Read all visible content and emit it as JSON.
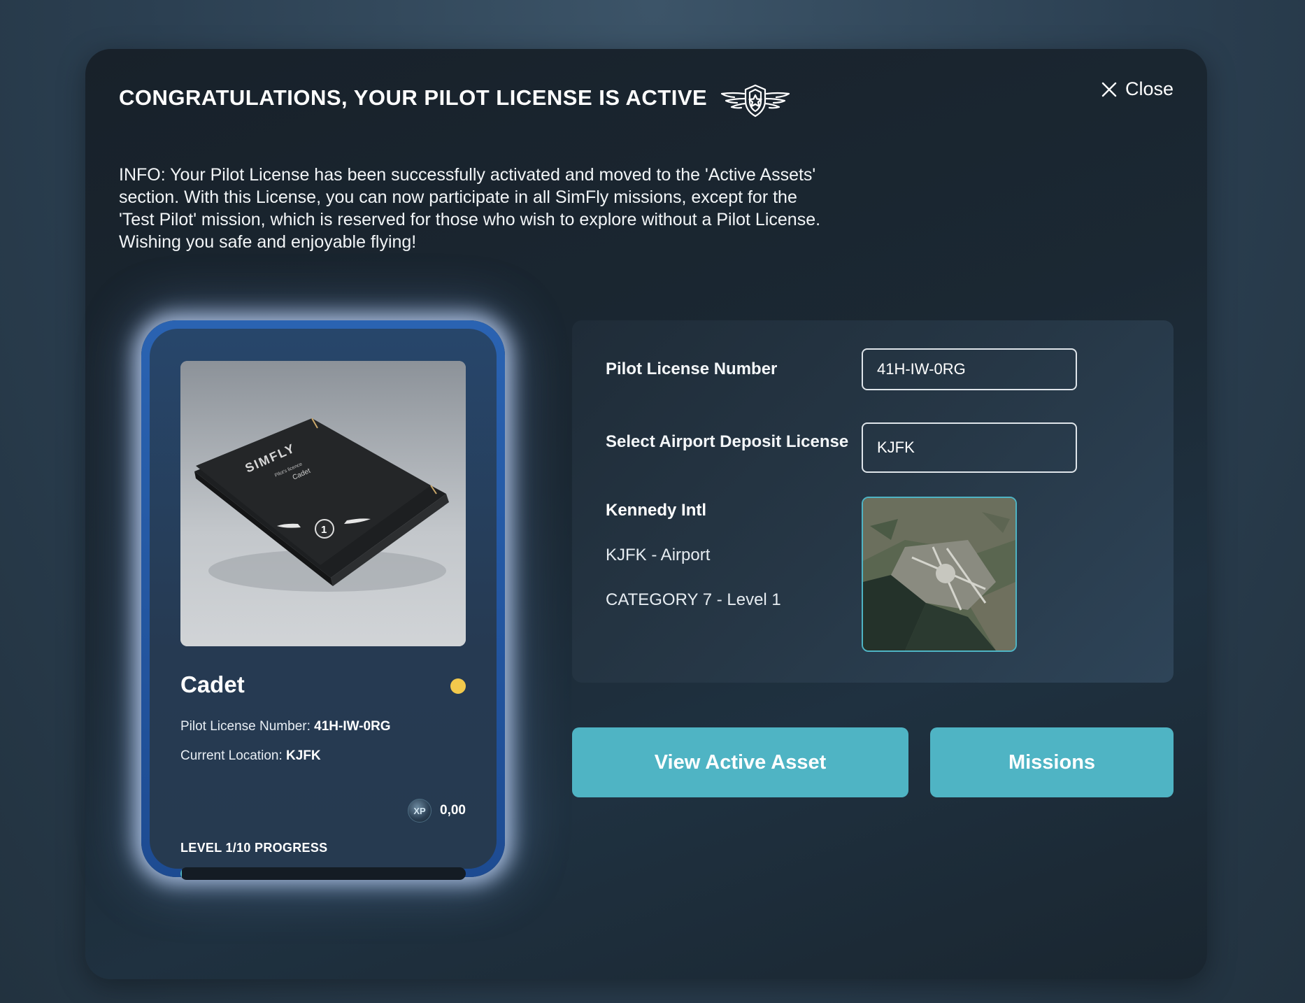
{
  "header": {
    "title": "CONGRATULATIONS, YOUR PILOT LICENSE IS ACTIVE",
    "close_label": "Close"
  },
  "info_text": "INFO: Your Pilot License has been successfully activated and moved to the 'Active Assets' section. With this License, you can now participate in all SimFly missions, except for the 'Test Pilot' mission, which is reserved for those who wish to explore without a Pilot License. Wishing you safe and enjoyable flying!",
  "card": {
    "image_brand": "SIMFLY",
    "image_subtitle": "Pilot's licence",
    "image_rank": "Cadet",
    "image_badge_number": "1",
    "name": "Cadet",
    "license_label": "Pilot License Number:",
    "license_value": "41H-IW-0RG",
    "location_label": "Current Location:",
    "location_value": "KJFK",
    "xp_icon_text": "XP",
    "xp_value": "0,00",
    "level_label": "LEVEL 1/10 PROGRESS",
    "progress_fraction": 0.005,
    "status_color": "#f2c94c"
  },
  "details": {
    "license_number_label": "Pilot License Number",
    "license_number_value": "41H-IW-0RG",
    "deposit_label": "Select Airport Deposit License",
    "deposit_value": "KJFK",
    "airport_name": "Kennedy Intl",
    "airport_code": "KJFK - Airport",
    "airport_category": "CATEGORY 7 - Level 1"
  },
  "buttons": {
    "view_active_asset": "View Active Asset",
    "missions": "Missions"
  },
  "colors": {
    "accent": "#4fb4c4",
    "card_border": "#2a63b2",
    "modal_bg": "#1b2833"
  }
}
